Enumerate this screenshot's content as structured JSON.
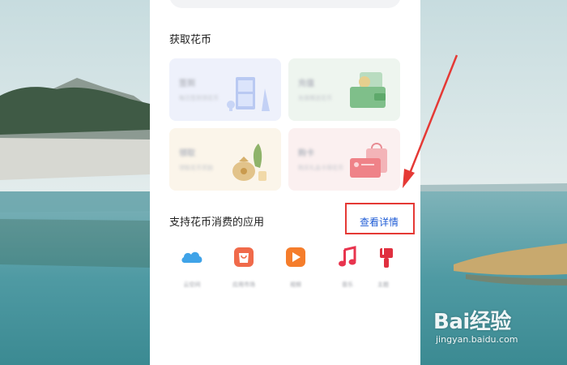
{
  "section_earn": {
    "title": "获取花币"
  },
  "earn_cards": [
    {
      "title": "签到",
      "subtitle": "每日签到领花币"
    },
    {
      "title": "充值",
      "subtitle": "充值赠送花币"
    },
    {
      "title": "领取",
      "subtitle": "领取花币奖励"
    },
    {
      "title": "购卡",
      "subtitle": "购买礼品卡得花币"
    }
  ],
  "section_apps": {
    "title": "支持花币消费的应用",
    "details_link": "查看详情"
  },
  "apps": [
    {
      "name": "云空间",
      "icon": "cloud-icon",
      "color": "#3fa3e8"
    },
    {
      "name": "应用市场",
      "icon": "shopping-bag-icon",
      "color": "#f06a4a"
    },
    {
      "name": "视频",
      "icon": "video-play-icon",
      "color": "#f57d2b"
    },
    {
      "name": "音乐",
      "icon": "music-note-icon",
      "color": "#e8344e"
    },
    {
      "name": "主题",
      "icon": "brush-icon",
      "color": "#e0303f"
    }
  ],
  "annotation": {
    "color": "#e53935"
  },
  "watermark": {
    "logo": "Bai经验",
    "url": "jingyan.baidu.com"
  }
}
